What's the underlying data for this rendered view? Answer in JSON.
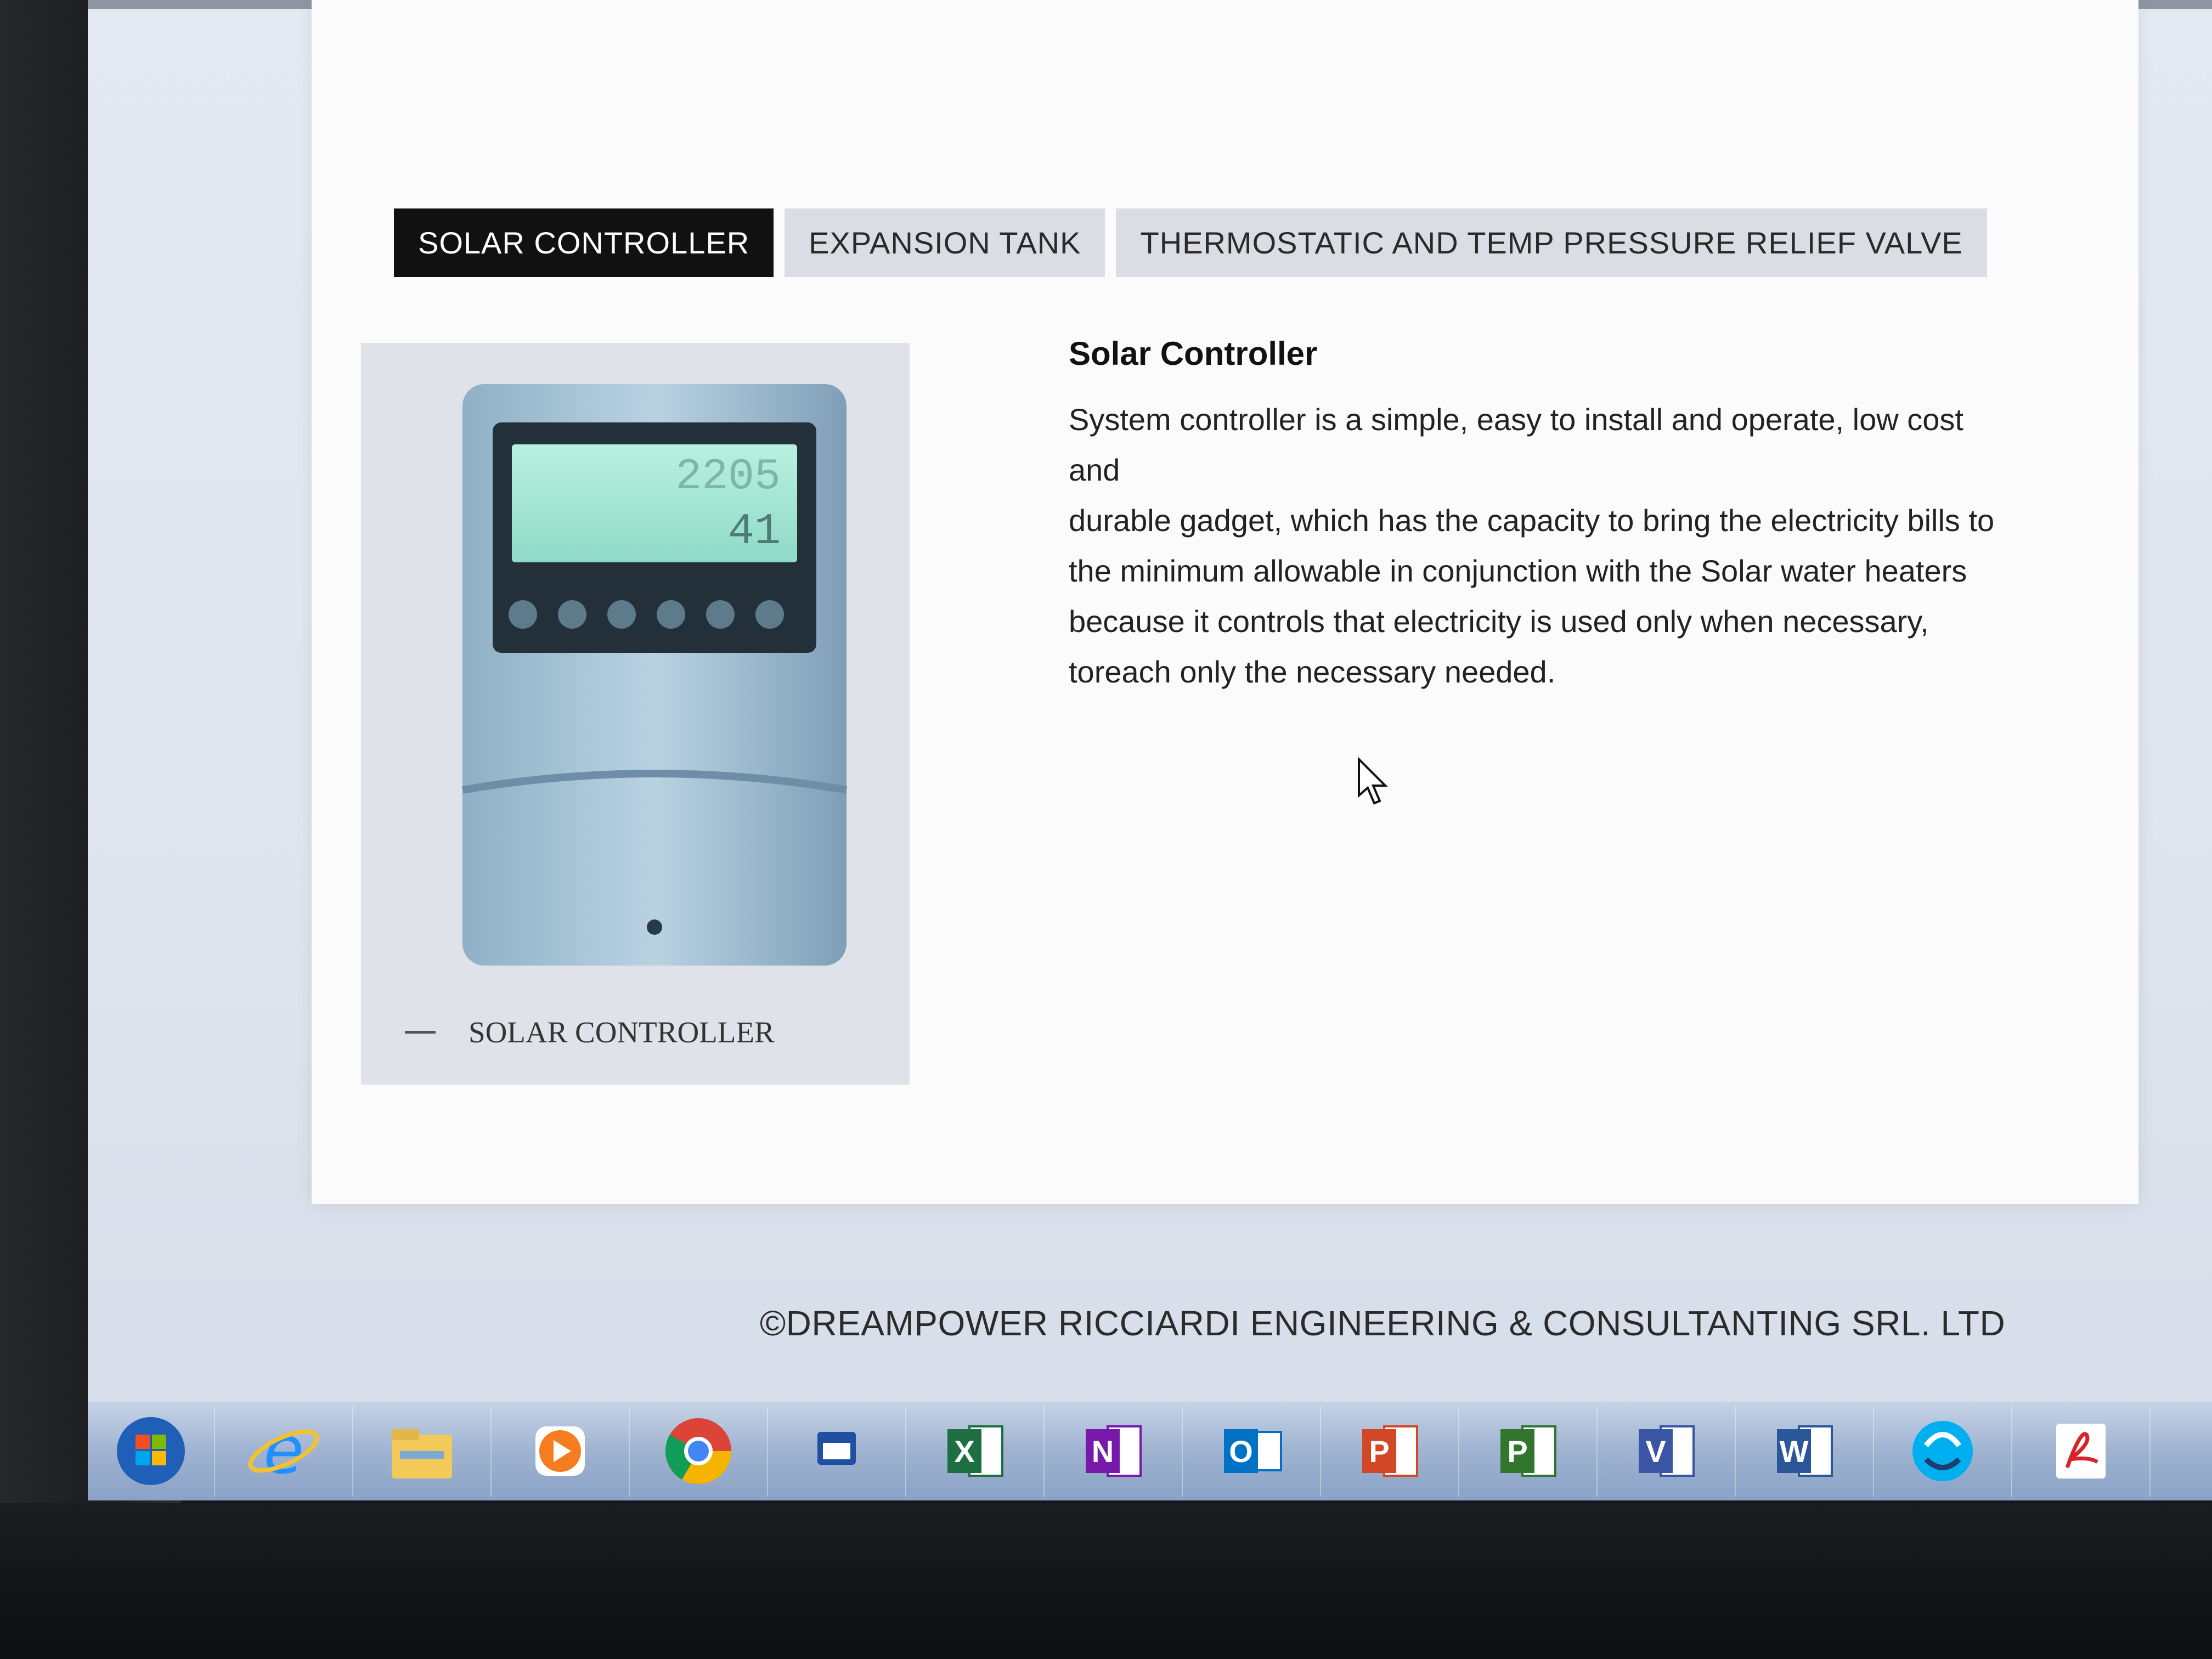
{
  "tabs": [
    {
      "label": "SOLAR CONTROLLER",
      "active": true
    },
    {
      "label": "EXPANSION TANK",
      "active": false
    },
    {
      "label": "THERMOSTATIC AND TEMP PRESSURE RELIEF VALVE",
      "active": false
    }
  ],
  "product": {
    "caption": "SOLAR CONTROLLER",
    "display_top": "2205",
    "display_bottom": "41"
  },
  "description": {
    "title": "Solar Controller",
    "lines": [
      "System controller is a simple, easy to install and operate, low cost",
      "and",
      "durable gadget, which has the capacity to bring the electricity bills to",
      "the minimum allowable in conjunction with the Solar water heaters",
      "because it controls that electricity is used only when necessary,",
      "toreach only the necessary needed."
    ]
  },
  "footer": {
    "copyright": "©DREAMPOWER RICCIARDI ENGINEERING & CONSULTANTING SRL. LTD"
  },
  "taskbar": {
    "icons": [
      "windows-start-icon",
      "internet-explorer-icon",
      "file-explorer-icon",
      "media-player-icon",
      "chrome-icon",
      "calendar-app-icon",
      "excel-icon",
      "onenote-icon",
      "outlook-icon",
      "powerpoint-icon",
      "project-icon",
      "visio-icon",
      "word-icon",
      "skype-icon",
      "acrobat-icon"
    ],
    "letters": {
      "excel": "X",
      "onenote": "N",
      "outlook": "O",
      "powerpoint": "P",
      "project": "P",
      "visio": "V",
      "word": "W"
    }
  }
}
